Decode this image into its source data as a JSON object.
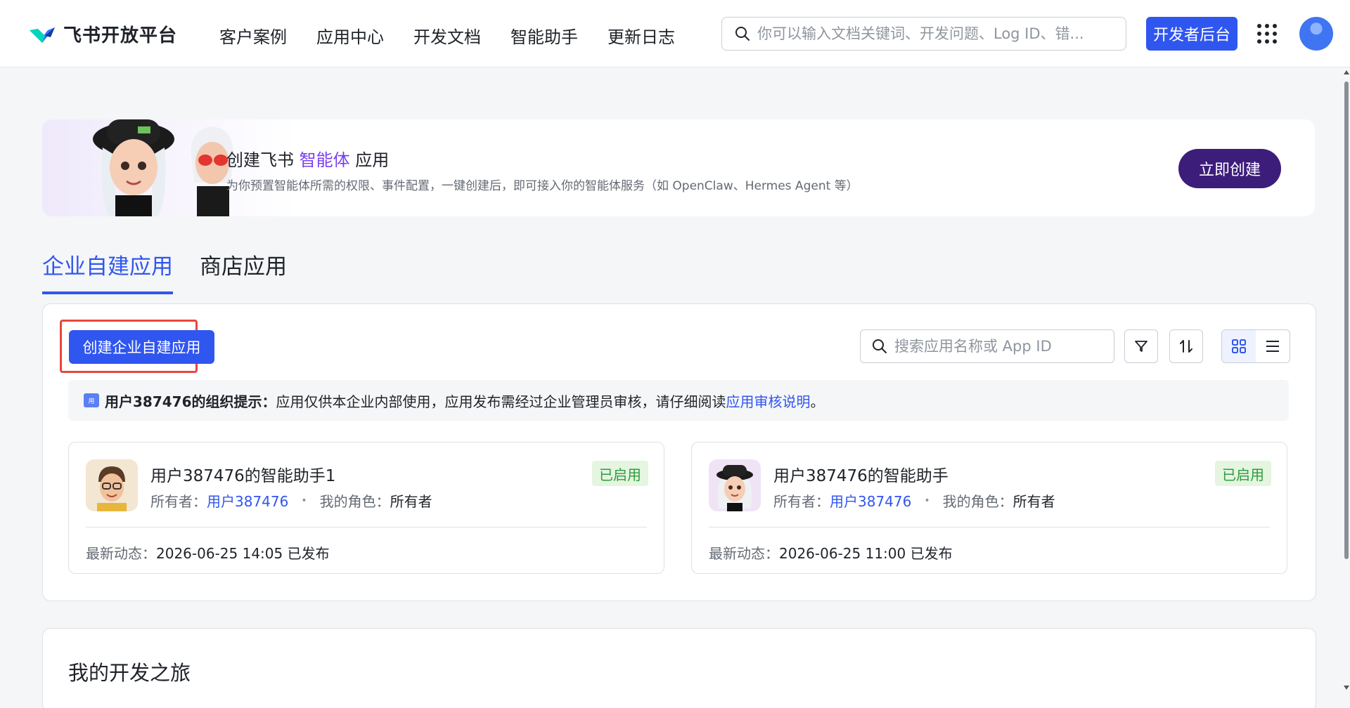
{
  "brand": {
    "name": "飞书开放平台"
  },
  "nav": [
    "客户案例",
    "应用中心",
    "开发文档",
    "智能助手",
    "更新日志"
  ],
  "top_search": {
    "placeholder": "你可以输入文档关键词、开发问题、Log ID、错..."
  },
  "dev_console_label": "开发者后台",
  "banner": {
    "title_prefix": "创建飞书",
    "title_highlight": "智能体",
    "title_suffix": "应用",
    "subtitle": "为你预置智能体所需的权限、事件配置，一键创建后，即可接入你的智能体服务（如 OpenClaw、Hermes Agent 等）",
    "cta": "立即创建"
  },
  "tabs": [
    {
      "label": "企业自建应用",
      "active": true
    },
    {
      "label": "商店应用",
      "active": false
    }
  ],
  "panel": {
    "create_button": "创建企业自建应用",
    "search_placeholder": "搜索应用名称或 App ID",
    "notice": {
      "icon_text": "用",
      "org": "用户387476的组织提示：",
      "text": "应用仅供本企业内部使用，应用发布需经过企业管理员审核，请仔细阅读",
      "link": "应用审核说明",
      "end": "。"
    }
  },
  "apps": [
    {
      "name": "用户387476的智能助手1",
      "status": "已启用",
      "owner_label": "所有者：",
      "owner": "用户387476",
      "role_label": "我的角色：",
      "role": "所有者",
      "latest_label": "最新动态：",
      "latest": "2026-06-25 14:05 已发布"
    },
    {
      "name": "用户387476的智能助手",
      "status": "已启用",
      "owner_label": "所有者：",
      "owner": "用户387476",
      "role_label": "我的角色：",
      "role": "所有者",
      "latest_label": "最新动态：",
      "latest": "2026-06-25 11:00 已发布"
    }
  ],
  "journey": {
    "title": "我的开发之旅"
  },
  "colors": {
    "primary": "#3056f0",
    "banner_button": "#3d1d7a",
    "highlight": "#7a3ef0",
    "enabled_badge": "#2e9b3c",
    "focus_frame": "#e8463b"
  }
}
